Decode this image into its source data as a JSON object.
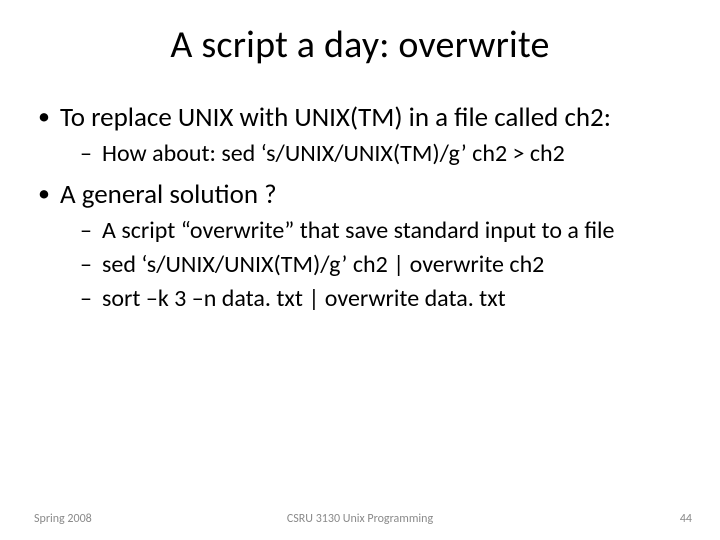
{
  "title": "A script a day: overwrite",
  "bullets": {
    "b1": "To replace UNIX with UNIX(TM) in a file called ch2:",
    "b1_sub1": "How about: sed ‘s/UNIX/UNIX(TM)/g’ ch2 > ch2",
    "b2": "A general solution ?",
    "b2_sub1": "A script “overwrite” that save standard input to a file",
    "b2_sub2": "sed ‘s/UNIX/UNIX(TM)/g’ ch2 | overwrite ch2",
    "b2_sub3": "sort –k 3 –n data. txt | overwrite data. txt"
  },
  "footer": {
    "left": "Spring 2008",
    "center": "CSRU 3130 Unix Programming",
    "right": "44"
  }
}
